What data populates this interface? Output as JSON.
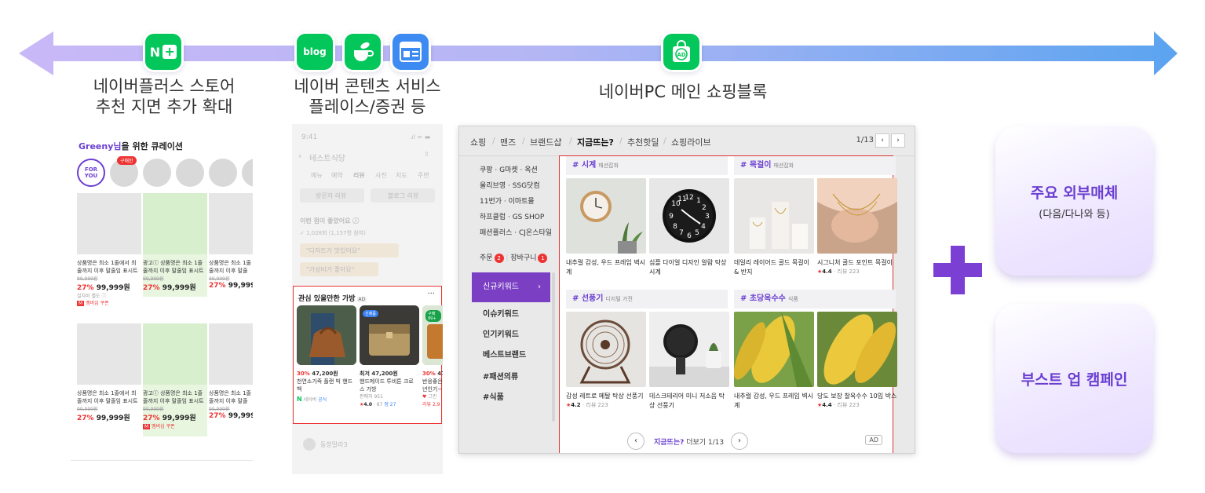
{
  "timeline": {
    "stops": [
      {
        "icons": [
          "naver-plus-icon"
        ],
        "caption_line1": "네이버플러스 스토어",
        "caption_line2": "추천 지면 추가 확대"
      },
      {
        "icons": [
          "blog-icon",
          "cafe-icon",
          "news-icon"
        ],
        "caption_line1": "네이버 콘텐츠 서비스",
        "caption_line2": "플레이스/증권 등"
      },
      {
        "icons": [
          "shopping-ad-icon"
        ],
        "caption_line1": "네이버PC 메인 쇼핑블록"
      }
    ],
    "icon_text": {
      "naver_plus": "N",
      "blog": "blog",
      "ad": "AD"
    },
    "colors": {
      "arrow_left": "#c9b8f7",
      "arrow_right": "#5ba4f0",
      "brand_green": "#03c75a",
      "accent_purple": "#6b3fd1"
    }
  },
  "curation": {
    "title_highlight": "Greeny님",
    "title_rest": "을 위한 큐레이션",
    "for_you": "FOR YOU",
    "new_badge": "구매한",
    "products": [
      {
        "title1": "상품명은 최소 1줄에서 최",
        "title2": "줄까지 이후 말줄임 표시트",
        "orig": "99,999원",
        "discount": "27%",
        "price": "99,999원",
        "shipping": "설치비 별도 ⓘ",
        "coupon": "멤버십 쿠폰",
        "highlight": false
      },
      {
        "title1": "광고ⓘ 상품명은 최소 1줄",
        "title2": "줄까지 이후 말줄임 표시트",
        "orig": "99,999원",
        "discount": "27%",
        "price": "99,999원",
        "shipping": "",
        "coupon": "",
        "highlight": true
      },
      {
        "title1": "상품명은 최소 1줄",
        "title2": "줄까지 이후 말줄",
        "orig": "99,999원",
        "discount": "27%",
        "price": "99,999",
        "shipping": "",
        "coupon": "",
        "highlight": false
      },
      {
        "title1": "상품명은 최소 1줄에서 최",
        "title2": "줄까지 이후 말줄임 표시트",
        "orig": "99,999원",
        "discount": "27%",
        "price": "99,999원",
        "shipping": "",
        "coupon": "",
        "highlight": false
      },
      {
        "title1": "광고ⓘ 상품명은 최소 1줄",
        "title2": "줄까지 이후 말줄임 표시트",
        "orig": "99,999원",
        "discount": "27%",
        "price": "99,999원",
        "shipping": "",
        "coupon": "멤버십 쿠폰",
        "highlight": true
      },
      {
        "title1": "상품명은 최소 1줄",
        "title2": "줄까지 이후 말줄",
        "orig": "99,999원",
        "discount": "27%",
        "price": "99,999",
        "shipping": "",
        "coupon": "",
        "highlight": false
      }
    ]
  },
  "phone": {
    "time": "9:41",
    "store_name": "테스트식당",
    "tabs": [
      "메뉴",
      "예약",
      "리뷰",
      "사진",
      "지도",
      "주변"
    ],
    "btn_left": "방문자 리뷰",
    "btn_right": "블로그 리뷰",
    "section": "이런 점이 좋았어요 ⓘ",
    "count": "✓ 1,028회 (1,157명 참여)",
    "kw1": "\"디저트가 맛있어요\"",
    "kw2": "\"가성비가 좋아요\"",
    "card_title": "관심 있을만한 가방",
    "card_ad": "AD",
    "card_more": "···",
    "items": [
      {
        "discount": "30%",
        "price": "47,200원",
        "name1": "천연소가죽 플랜 빅 핸드",
        "name2": "백",
        "seller": "네이버",
        "seller_tag": "공식",
        "tag": ""
      },
      {
        "discount": "최저",
        "price": "47,200원",
        "name1": "핸드메이드 투비튼 크로",
        "name2": "스 가방",
        "seller": "판매처 951",
        "rating": "4.0",
        "reviews": "87",
        "points": "점 27",
        "tag": "신제품"
      },
      {
        "discount": "30%",
        "price": "47",
        "name1": "반응좋은 ",
        "name2": "년인기~",
        "seller": "그린",
        "reviews": "리뷰 2,9",
        "tag": "구매 99+"
      }
    ],
    "footer": "동창말라3"
  },
  "shopping": {
    "tabs": [
      "쇼핑",
      "맨즈",
      "브랜드샵",
      "지금뜨는?",
      "추천핫딜",
      "쇼핑라이브"
    ],
    "active_tab": "지금뜨는?",
    "page": "1/13",
    "malls": [
      "쿠팡 · G마켓 · 옥션",
      "올리브영 · SSG닷컴",
      "11번가 · 이마트몰",
      "하프클럽 · GS SHOP",
      "패션플러스 · CJ온스타일"
    ],
    "order": "주문",
    "order_count": "2",
    "cart": "장바구니",
    "cart_count": "1",
    "keywords": [
      "신규키워드",
      "이슈키워드",
      "인기키워드",
      "베스트브랜드",
      "#패션의류",
      "#식품"
    ],
    "sections": [
      {
        "tag": "# 시계",
        "sub": "패션잡화",
        "items": [
          {
            "name": "내추럴 감성, 우드 프레임 벽시계",
            "rating": "",
            "reviews": ""
          },
          {
            "name": "심플 다이얼 디자인 알람 탁상시계",
            "rating": "",
            "reviews": ""
          }
        ]
      },
      {
        "tag": "# 목걸이",
        "sub": "패션잡화",
        "items": [
          {
            "name": "데일리 레이어드 골드 목걸이 & 반지",
            "rating": "",
            "reviews": ""
          },
          {
            "name": "시그니처 골드 포인트 목걸이",
            "rating": "4.4",
            "reviews": "리뷰 223"
          }
        ]
      },
      {
        "tag": "# 선풍기",
        "sub": "디지털 가전",
        "items": [
          {
            "name": "감성 레트로 메탈 탁상 선풍기",
            "rating": "4.2",
            "reviews": "리뷰 223"
          },
          {
            "name": "데스크테리어 미니 저소음 탁상 선풍기",
            "rating": "",
            "reviews": ""
          }
        ]
      },
      {
        "tag": "# 초당옥수수",
        "sub": "식품",
        "items": [
          {
            "name": "내추럴 감성, 우드 프레임 벽시계",
            "rating": "",
            "reviews": ""
          },
          {
            "name": "당도 보장 찰옥수수 10입 박스",
            "rating": "4.4",
            "reviews": "리뷰 223"
          }
        ]
      }
    ],
    "more_hl": "지금뜨는?",
    "more_rest": " 더보기 1/13",
    "ad": "AD"
  },
  "right": {
    "box1_main": "주요 외부매체",
    "box1_sub": "(다음/다나와 등)",
    "box2_main": "부스트 업 캠페인"
  }
}
